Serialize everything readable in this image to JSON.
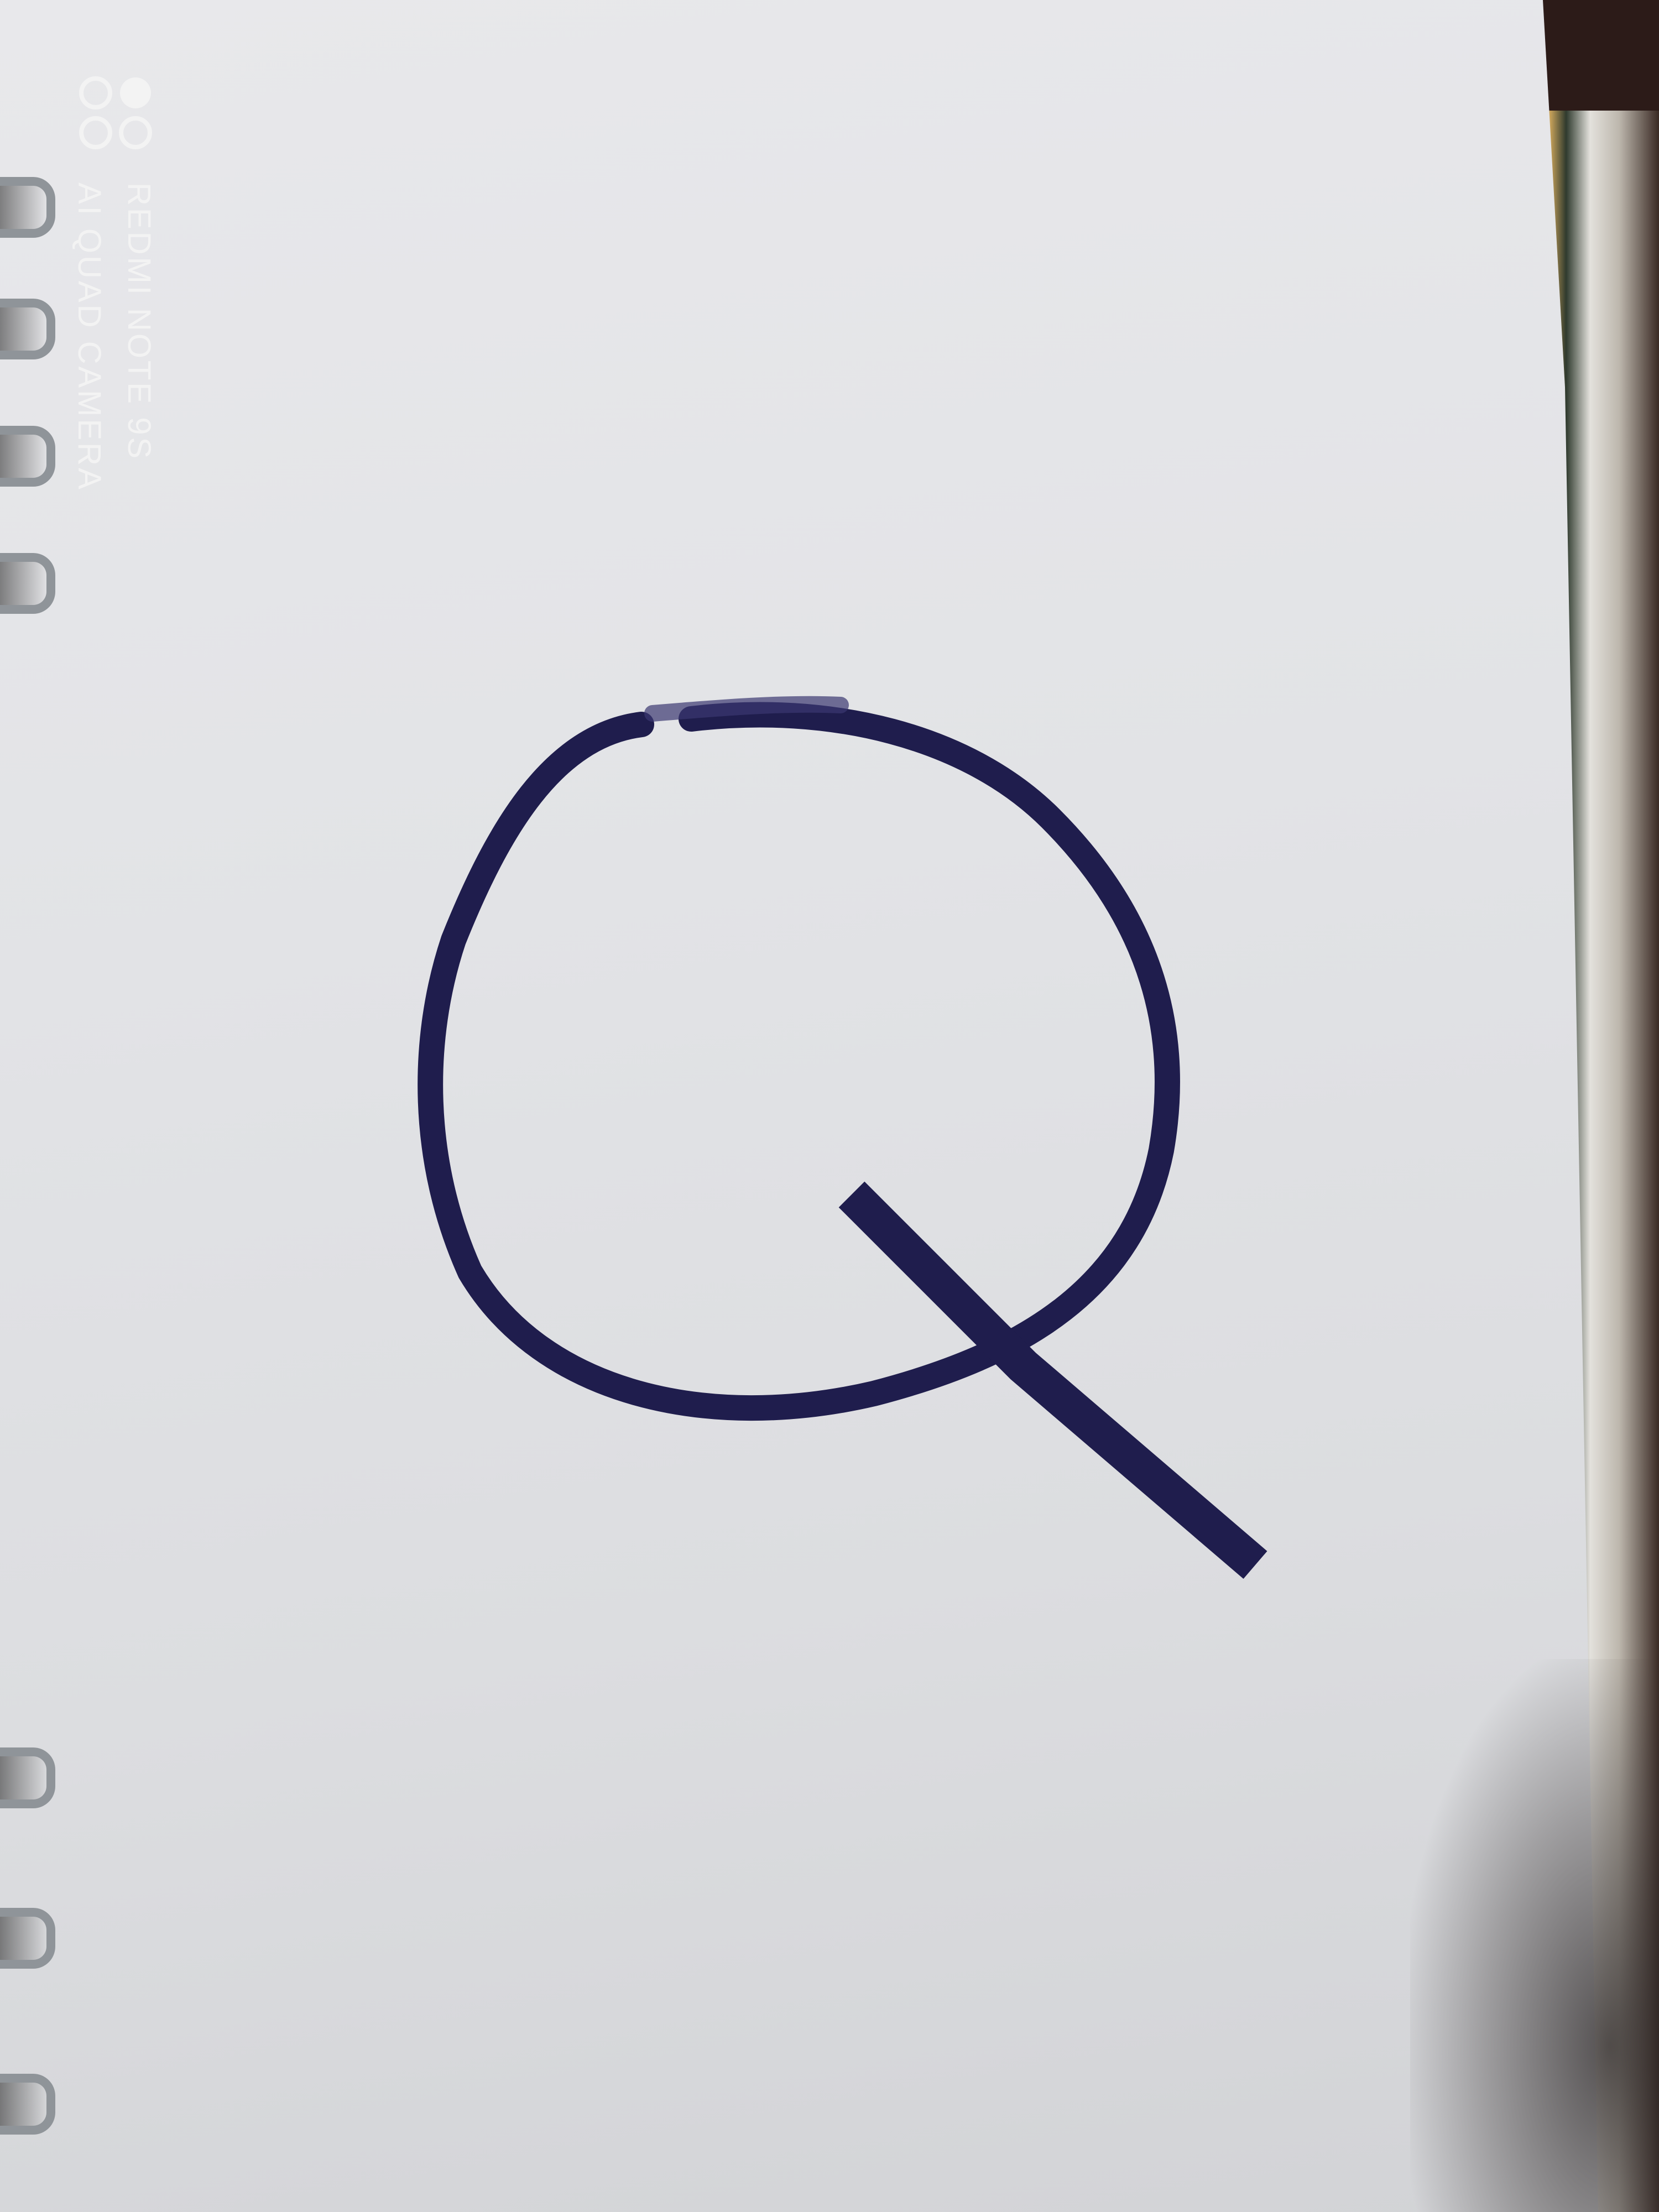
{
  "photo": {
    "subject": "Q",
    "ink_color": "#1f1d4d",
    "paper_color": "#e3e4e7"
  },
  "watermark": {
    "line1": "REDMI NOTE 9S",
    "line2": "AI QUAD CAMERA"
  }
}
